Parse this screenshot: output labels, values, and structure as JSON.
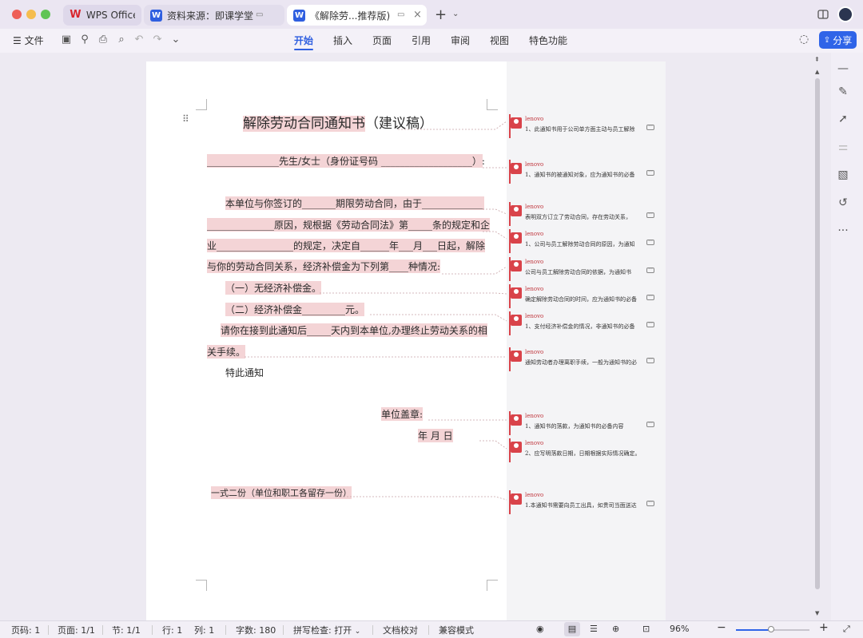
{
  "titlebar": {
    "tabs": [
      {
        "label": "WPS Office",
        "logo": "wps-logo"
      },
      {
        "label": "资料来源：即课学堂",
        "logo": "W"
      },
      {
        "label": "《解除劳...推荐版)",
        "logo": "W"
      }
    ]
  },
  "toolbar": {
    "file_label": "文件",
    "menu": [
      "开始",
      "插入",
      "页面",
      "引用",
      "审阅",
      "视图",
      "特色功能"
    ],
    "active_menu": "开始",
    "share_label": "分享"
  },
  "document": {
    "title": "解除劳动合同通知书",
    "title_suffix": "（建议稿）",
    "addressee": "_______________先生/女士（身份证号码 ___________________）:",
    "para1_l1": "本单位与你签订的_______期限劳动合同，由于_____________",
    "para1_l2": "______________原因，规根据《劳动合同法》第_____条的规定和企",
    "para1_l3": "业________________的规定，决定自______年___月___日起，解除",
    "para1_l4": "与你的劳动合同关系，经济补偿金为下列第____种情况:",
    "option1": "（一）无经济补偿金。",
    "option2": "（二）经济补偿金_________元。",
    "para2_l1": "请你在接到此通知后_____天内到本单位,办理终止劳动关系的相",
    "para2_l2": "关手续。",
    "notice": "特此通知",
    "seal": "单位盖章:",
    "date": "年      月      日",
    "copies": "一式二份（单位和职工各留存一份）"
  },
  "comments": [
    {
      "author": "lenovo",
      "text": "1、此通知书用于公司单方面主动与员工解除"
    },
    {
      "author": "lenovo",
      "text": "1、通知书的被通知对象，应为通知书的必备"
    },
    {
      "author": "lenovo",
      "text": "表明双方订立了劳动合同，存在劳动关系，"
    },
    {
      "author": "lenovo",
      "text": "1、公司与员工解除劳动合同的原因，为通知"
    },
    {
      "author": "lenovo",
      "text": "公司与员工解除劳动合同的依据，为通知书"
    },
    {
      "author": "lenovo",
      "text": "确定解除劳动合同的时间，应为通知书的必备"
    },
    {
      "author": "lenovo",
      "text": "1、支付经济补偿金的情况，非通知书的必备"
    },
    {
      "author": "lenovo",
      "text": "通知劳动者办理离职手续，一般为通知书的必"
    },
    {
      "author": "lenovo",
      "text": "1、通知书的落款，为通知书的必备内容"
    },
    {
      "author": "lenovo",
      "text": "2、应写明落款日期，日期根据实际情况确定。"
    },
    {
      "author": "lenovo",
      "text": "1.本通知书需要向员工出具，如贵司当面送达"
    }
  ],
  "statusbar": {
    "page_code": "页码: 1",
    "pages": "页面: 1/1",
    "section": "节: 1/1",
    "row": "行: 1",
    "col": "列: 1",
    "word_count": "字数: 180",
    "spellcheck": "拼写检查: 打开",
    "proofread": "文档校对",
    "compat": "兼容模式",
    "zoom": "96%"
  },
  "zoom_level": 0.48,
  "colors": {
    "accent": "#2f5fe0",
    "highlight": "#f4d4d6",
    "comment": "#d9434a"
  }
}
